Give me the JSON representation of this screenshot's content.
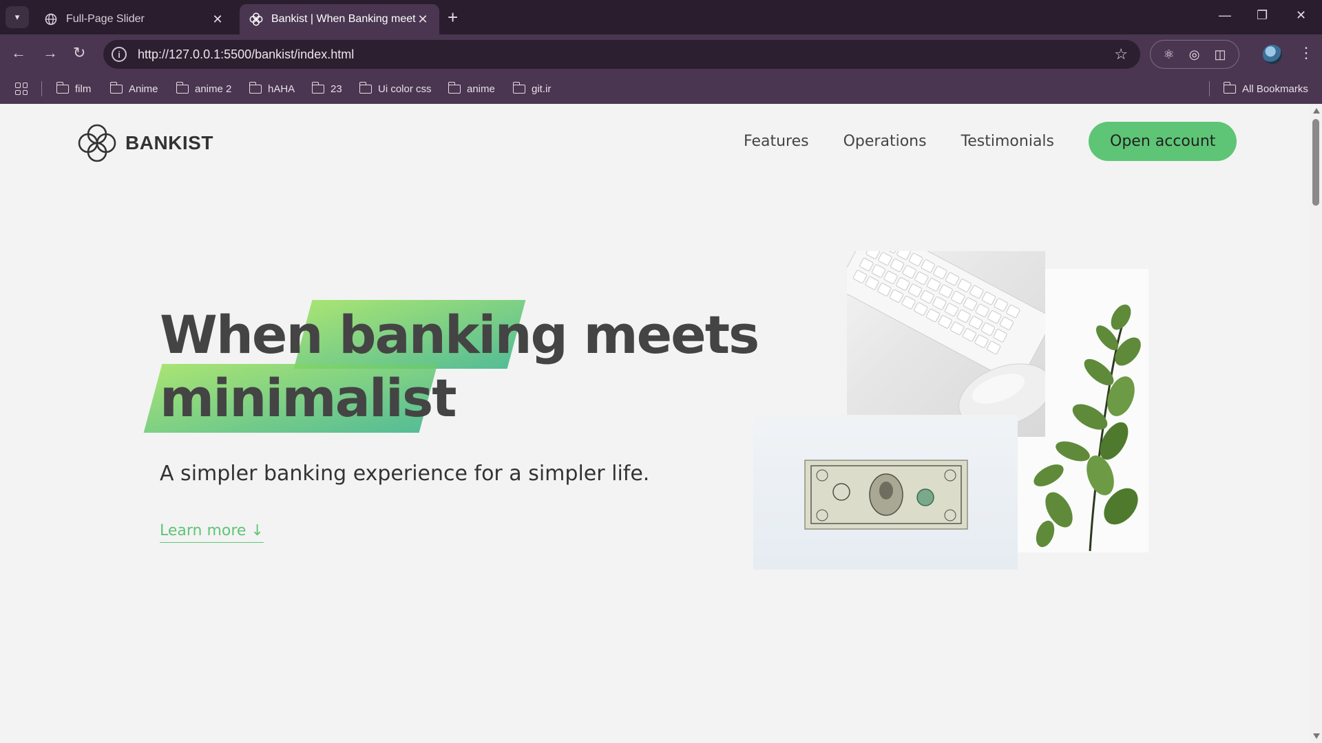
{
  "browser": {
    "tabs": [
      {
        "title": "Full-Page Slider",
        "active": false
      },
      {
        "title": "Bankist | When Banking meets Minimalist",
        "active": true
      }
    ],
    "url": "http://127.0.0.1:5500/bankist/index.html",
    "bookmarks": [
      "film",
      "Anime",
      "anime 2",
      "hAHA",
      "23",
      "Ui color css",
      "anime",
      "git.ir"
    ],
    "all_bookmarks": "All Bookmarks"
  },
  "site": {
    "logo_text": "BANKIST",
    "nav": {
      "features": "Features",
      "operations": "Operations",
      "testimonials": "Testimonials",
      "cta": "Open account"
    },
    "hero": {
      "word_when": "When",
      "word_banking": "banking",
      "word_meets": "meets",
      "word_minimalist": "minimalist",
      "subtitle": "A simpler banking experience for a simpler life.",
      "learn_more": "Learn more ↓"
    }
  },
  "colors": {
    "accent_green": "#5ec576",
    "highlight_start": "#9be15d",
    "highlight_end": "#39b385",
    "chrome_dark": "#2a1d2e",
    "chrome_mid": "#4a3650"
  }
}
